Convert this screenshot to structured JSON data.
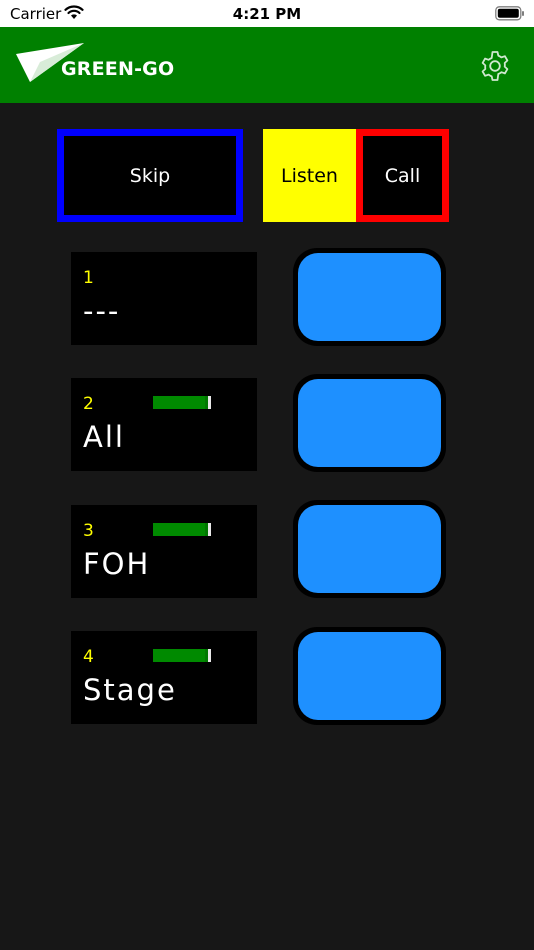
{
  "status_bar": {
    "carrier": "Carrier",
    "time": "4:21 PM",
    "icons": [
      "wifi-icon",
      "battery-icon"
    ]
  },
  "header": {
    "brand": "GREEN-GO",
    "icons": [
      "paper-plane-logo-icon",
      "gear-icon"
    ]
  },
  "top_buttons": {
    "skip": "Skip",
    "listen": "Listen",
    "call": "Call"
  },
  "channels": [
    {
      "number": "1",
      "name": "---",
      "meter": false
    },
    {
      "number": "2",
      "name": "All",
      "meter": true,
      "level": 0.95
    },
    {
      "number": "3",
      "name": "FOH",
      "meter": true,
      "level": 0.95
    },
    {
      "number": "4",
      "name": "Stage",
      "meter": true,
      "level": 0.95
    }
  ],
  "colors": {
    "header": "#008000",
    "background": "#171717",
    "skip_border": "#0000ff",
    "listen_bg": "#ffff00",
    "call_border": "#ff0000",
    "channel_number": "#ffff00",
    "talk_button": "#1e90ff",
    "meter": "#008000"
  }
}
